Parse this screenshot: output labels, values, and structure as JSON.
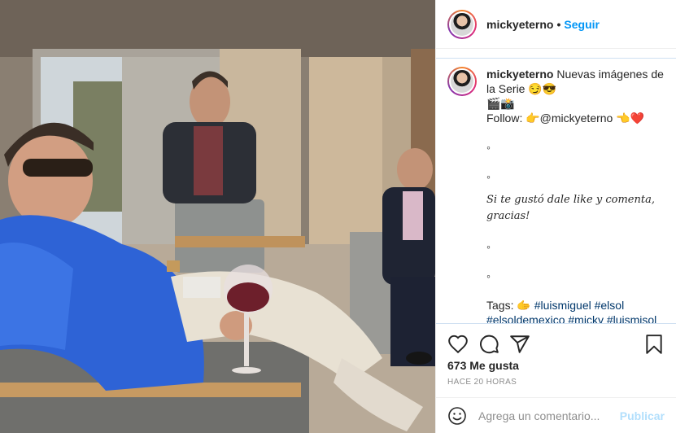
{
  "header": {
    "username": "mickyeterno",
    "separator": "•",
    "follow_label": "Seguir"
  },
  "caption": {
    "username": "mickyeterno",
    "line1": "Nuevas imágenes de la Serie 😏😎",
    "line2": "🎬📸",
    "line3": "Follow: 👉@mickyeterno 👈❤️",
    "dot1": "◦",
    "dot2": "◦",
    "fancy": "Si te gustó dale like y comenta, gracias!",
    "dot3": "◦",
    "dot4": "◦",
    "tags_prefix": "Tags: 🫱",
    "tags": "#luismiguel #elsol #elsoldemexico #micky #luismisol #luismigueloficial #luismi #mexico #tbt #mickybasteri #cantante #lmxml"
  },
  "stats": {
    "likes": "673 Me gusta",
    "time_ago": "HACE 20 HORAS"
  },
  "comment_box": {
    "placeholder": "Agrega un comentario...",
    "post_label": "Publicar"
  },
  "icons": {
    "like": "heart-icon",
    "comment": "comment-icon",
    "share": "share-icon",
    "save": "bookmark-icon",
    "emoji": "emoji-icon"
  },
  "colors": {
    "accent": "#0095f6",
    "hashtag": "#00376b",
    "muted": "#8e8e8e",
    "post_disabled": "#b2dffc"
  }
}
